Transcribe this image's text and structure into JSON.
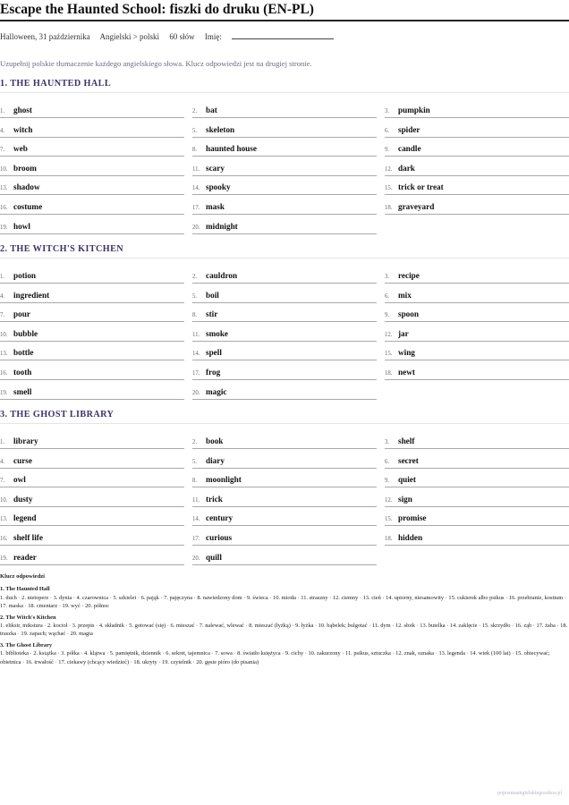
{
  "header": {
    "title": "Escape the Haunted School: fiszki do druku (EN-PL)",
    "date": "Halloween, 31 października",
    "breadcrumb": "Angielski > polski",
    "word_count": "60 słów",
    "name_label": "Imię:"
  },
  "instructions": "Uzupełnij polskie tłumaczenie każdego angielskiego słowa. Klucz odpowiedzi jest na drugiej stronie.",
  "sections": [
    {
      "title": "1. THE HAUNTED HALL",
      "items": [
        {
          "num": "1.",
          "word": "ghost"
        },
        {
          "num": "2.",
          "word": "bat"
        },
        {
          "num": "3.",
          "word": "pumpkin"
        },
        {
          "num": "4.",
          "word": "witch"
        },
        {
          "num": "5.",
          "word": "skeleton"
        },
        {
          "num": "6.",
          "word": "spider"
        },
        {
          "num": "7.",
          "word": "web"
        },
        {
          "num": "8.",
          "word": "haunted house"
        },
        {
          "num": "9.",
          "word": "candle"
        },
        {
          "num": "10.",
          "word": "broom"
        },
        {
          "num": "11.",
          "word": "scary"
        },
        {
          "num": "12.",
          "word": "dark"
        },
        {
          "num": "13.",
          "word": "shadow"
        },
        {
          "num": "14.",
          "word": "spooky"
        },
        {
          "num": "15.",
          "word": "trick or treat"
        },
        {
          "num": "16.",
          "word": "costume"
        },
        {
          "num": "17.",
          "word": "mask"
        },
        {
          "num": "18.",
          "word": "graveyard"
        },
        {
          "num": "19.",
          "word": "howl"
        },
        {
          "num": "20.",
          "word": "midnight"
        }
      ]
    },
    {
      "title": "2. THE WITCH'S KITCHEN",
      "items": [
        {
          "num": "1.",
          "word": "potion"
        },
        {
          "num": "2.",
          "word": "cauldron"
        },
        {
          "num": "3.",
          "word": "recipe"
        },
        {
          "num": "4.",
          "word": "ingredient"
        },
        {
          "num": "5.",
          "word": "boil"
        },
        {
          "num": "6.",
          "word": "mix"
        },
        {
          "num": "7.",
          "word": "pour"
        },
        {
          "num": "8.",
          "word": "stir"
        },
        {
          "num": "9.",
          "word": "spoon"
        },
        {
          "num": "10.",
          "word": "bubble"
        },
        {
          "num": "11.",
          "word": "smoke"
        },
        {
          "num": "12.",
          "word": "jar"
        },
        {
          "num": "13.",
          "word": "bottle"
        },
        {
          "num": "14.",
          "word": "spell"
        },
        {
          "num": "15.",
          "word": "wing"
        },
        {
          "num": "16.",
          "word": "tooth"
        },
        {
          "num": "17.",
          "word": "frog"
        },
        {
          "num": "18.",
          "word": "newt"
        },
        {
          "num": "19.",
          "word": "smell"
        },
        {
          "num": "20.",
          "word": "magic"
        }
      ]
    },
    {
      "title": "3. THE GHOST LIBRARY",
      "items": [
        {
          "num": "1.",
          "word": "library"
        },
        {
          "num": "2.",
          "word": "book"
        },
        {
          "num": "3.",
          "word": "shelf"
        },
        {
          "num": "4.",
          "word": "curse"
        },
        {
          "num": "5.",
          "word": "diary"
        },
        {
          "num": "6.",
          "word": "secret"
        },
        {
          "num": "7.",
          "word": "owl"
        },
        {
          "num": "8.",
          "word": "moonlight"
        },
        {
          "num": "9.",
          "word": "quiet"
        },
        {
          "num": "10.",
          "word": "dusty"
        },
        {
          "num": "11.",
          "word": "trick"
        },
        {
          "num": "12.",
          "word": "sign"
        },
        {
          "num": "13.",
          "word": "legend"
        },
        {
          "num": "14.",
          "word": "century"
        },
        {
          "num": "15.",
          "word": "promise"
        },
        {
          "num": "16.",
          "word": "shelf life"
        },
        {
          "num": "17.",
          "word": "curious"
        },
        {
          "num": "18.",
          "word": "hidden"
        },
        {
          "num": "19.",
          "word": "reader"
        },
        {
          "num": "20.",
          "word": "quill"
        }
      ]
    }
  ],
  "answer_key": {
    "title": "Klucz odpowiedzi",
    "sections": [
      {
        "title": "1. The Haunted Hall",
        "text": "1. duch · 2. nietoperz · 3. dynia · 4. czarownica · 5. szkielet · 6. pająk · 7. pajęczyna · 8. nawiedzony dom · 9. świeca · 10. miotła · 11. straszny · 12. ciemny · 13. cień · 14. upiorny, niesamowity · 15. cukierek albo psikus · 16. przebranie, kostium · 17. maska · 18. cmentarz · 19. wyć · 20. północ"
      },
      {
        "title": "2. The Witch's Kitchen",
        "text": "1. eliksir, mikstura · 2. kocioł · 3. przepis · 4. składnik · 5. gotować (się) · 6. mieszać · 7. nalewać, wlewać · 8. mieszać (łyżką) · 9. łyżka · 10. bąbelek; bulgotać · 11. dym · 12. słoik · 13. butelka · 14. zaklęcie · 15. skrzydło · 16. ząb · 17. żaba · 18. traszka · 19. zapach; wąchać · 20. magia"
      },
      {
        "title": "3. The Ghost Library",
        "text": "1. biblioteka · 2. książka · 3. półka · 4. klątwa · 5. pamiętnik, dziennik · 6. sekret, tajemnica · 7. sowa · 8. światło księżyca · 9. cichy · 10. zakurzony · 11. psikus, sztuczka · 12. znak, oznaka · 13. legenda · 14. wiek (100 lat) · 15. obiecywać; obietnica · 16. trwałość · 17. ciekawy (chcący wiedzieć) · 18. ukryty · 19. czytelnik · 20. gęsie pióro (do pisania)"
      }
    ]
  },
  "footer": "poposmaangielskiegoszkoa.pl",
  "colors": {
    "section_title": "#3e3168",
    "instructions": "#6e6a82",
    "item_rule": "#a9a9a9"
  }
}
